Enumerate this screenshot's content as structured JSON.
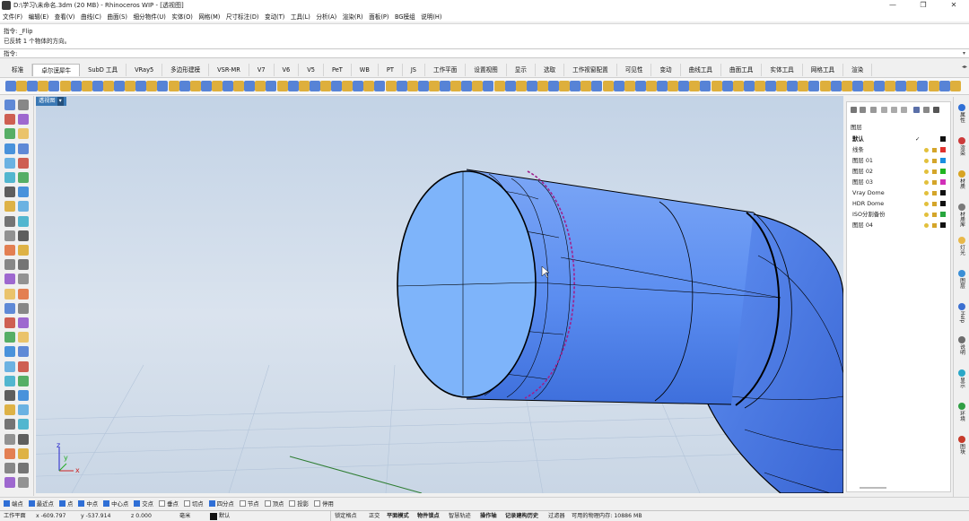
{
  "window": {
    "title": "D:\\学习\\未命名.3dm (20 MB) - Rhinoceros WIP - [透视图]",
    "controls": [
      "—",
      "❐",
      "✕"
    ]
  },
  "menu": [
    "文件(F)",
    "编辑(E)",
    "查看(V)",
    "曲线(C)",
    "曲面(S)",
    "细分物件(U)",
    "实体(O)",
    "网格(M)",
    "尺寸标注(D)",
    "变动(T)",
    "工具(L)",
    "分析(A)",
    "渲染(R)",
    "面板(P)",
    "BG模组",
    "说明(H)"
  ],
  "command": {
    "history": [
      "指令: _Flip",
      "已反转 1 个物体的方向。"
    ],
    "prompt": "指令:"
  },
  "tabs": [
    "标准",
    "卓尔谟犀牛",
    "SubD 工具",
    "VRay5",
    "多边形建模",
    "VSR-MR",
    "V7",
    "V6",
    "V5",
    "PeT",
    "WB",
    "PT",
    "JS",
    "工作平面",
    "设置视图",
    "显示",
    "选取",
    "工作视窗配置",
    "可见性",
    "变动",
    "曲线工具",
    "曲面工具",
    "实体工具",
    "网格工具",
    "渲染"
  ],
  "active_tab": "卓尔谟犀牛",
  "viewport": {
    "label": "透视图",
    "menu_arrow": "▾",
    "axes": {
      "x": "x",
      "y": "y",
      "z": "z"
    }
  },
  "layers_panel": {
    "header": "图层",
    "layers": [
      {
        "name": "默认",
        "bold": true,
        "current": true,
        "color": "#111111"
      },
      {
        "name": "线条",
        "color": "#e0322d"
      },
      {
        "name": "图层 01",
        "color": "#1a8fe0"
      },
      {
        "name": "图层 02",
        "color": "#21b521"
      },
      {
        "name": "图层 03",
        "color": "#d12fb8"
      },
      {
        "name": "Vray Dome",
        "color": "#111111"
      },
      {
        "name": "HDR Dome",
        "color": "#111111"
      },
      {
        "name": "ISO分割备份",
        "color": "#27a63e"
      },
      {
        "name": "图层 04",
        "color": "#111111"
      }
    ]
  },
  "side_tabs": [
    "属性",
    "渲染",
    "材质",
    "材质库",
    "灯光",
    "图层",
    "Help",
    "说明",
    "显示",
    "环境",
    "图块"
  ],
  "osnap": [
    {
      "label": "端点",
      "checked": true
    },
    {
      "label": "最近点",
      "checked": true
    },
    {
      "label": "点",
      "checked": true
    },
    {
      "label": "中点",
      "checked": true
    },
    {
      "label": "中心点",
      "checked": true
    },
    {
      "label": "交点",
      "checked": true
    },
    {
      "label": "垂点",
      "checked": false
    },
    {
      "label": "切点",
      "checked": false
    },
    {
      "label": "四分点",
      "checked": true
    },
    {
      "label": "节点",
      "checked": false
    },
    {
      "label": "顶点",
      "checked": false
    },
    {
      "label": "投影",
      "checked": false
    },
    {
      "label": "停用",
      "checked": false
    }
  ],
  "status": {
    "cplane": "工作平面",
    "x": "x -609.797",
    "y": "y -537.914",
    "z": "z 0.000",
    "unit": "毫米",
    "layer": "默认",
    "toggles": [
      {
        "label": "锁定格点",
        "bold": false
      },
      {
        "label": "正交",
        "bold": false
      },
      {
        "label": "平面模式",
        "bold": true
      },
      {
        "label": "物件锁点",
        "bold": true
      },
      {
        "label": "智慧轨迹",
        "bold": false
      },
      {
        "label": "操作轴",
        "bold": true
      },
      {
        "label": "记录建构历史",
        "bold": true
      },
      {
        "label": "过滤器",
        "bold": false
      }
    ],
    "memory": "可用的物理内存: 10886 MB"
  },
  "colors": {
    "accent": "#2f6fd6",
    "pipe": "#5b8df0",
    "viewport_label": "#3a78b4",
    "seam": "#a0208c"
  }
}
